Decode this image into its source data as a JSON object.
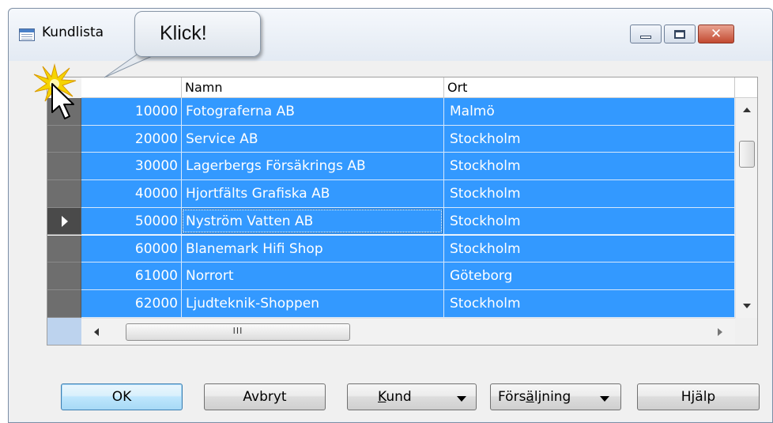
{
  "window": {
    "title": "Kundlista",
    "controls": {
      "minimize": "minimize",
      "maximize": "maximize",
      "close": "✕"
    }
  },
  "callout": {
    "text": "Klick!"
  },
  "grid": {
    "columns": [
      {
        "key": "no",
        "label": ""
      },
      {
        "key": "name",
        "label": "Namn"
      },
      {
        "key": "city",
        "label": "Ort"
      }
    ],
    "rows": [
      {
        "no": "10000",
        "name": "Fotograferna AB",
        "city": "Malmö"
      },
      {
        "no": "20000",
        "name": "Service AB",
        "city": "Stockholm"
      },
      {
        "no": "30000",
        "name": "Lagerbergs Försäkrings AB",
        "city": "Stockholm"
      },
      {
        "no": "40000",
        "name": "Hjortfälts Grafiska AB",
        "city": "Stockholm"
      },
      {
        "no": "50000",
        "name": "Nyström Vatten AB",
        "city": "Stockholm"
      },
      {
        "no": "60000",
        "name": "Blanemark Hifi Shop",
        "city": "Stockholm"
      },
      {
        "no": "61000",
        "name": "Norrort",
        "city": "Göteborg"
      },
      {
        "no": "62000",
        "name": "Ljudteknik-Shoppen",
        "city": "Stockholm"
      }
    ],
    "current_row_index": 4,
    "all_rows_selected": true,
    "hscroll_thumb_glyph": "III"
  },
  "buttons": {
    "ok": "OK",
    "cancel": "Avbryt",
    "kund_prefix": "",
    "kund_mnemonic": "K",
    "kund_rest": "und",
    "sales_prefix": "Förs",
    "sales_mnemonic": "ä",
    "sales_rest": "ljning",
    "help": "Hjälp"
  },
  "colors": {
    "selection": "#3399ff",
    "row_selector": "#6e6e6e",
    "starburst": "#f5d400"
  }
}
